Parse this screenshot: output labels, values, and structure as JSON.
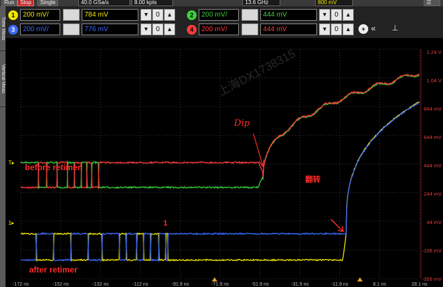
{
  "toolbar": {
    "run": "Run",
    "stop": "Stop",
    "single": "Single",
    "sample_rate": "40.0 GSa/s",
    "memory": "8.00 kpts",
    "bandwidth": "13.6 GHz",
    "trig_level": "800 mV"
  },
  "channels": [
    {
      "num": "1",
      "color": "#f2e600",
      "scale": "200 mV/",
      "offset": "784 mV"
    },
    {
      "num": "2",
      "color": "#3ad23a",
      "scale": "200 mV/",
      "offset": "444 mV"
    },
    {
      "num": "3",
      "color": "#3a6bff",
      "scale": "200 mV/",
      "offset": "776 mV"
    },
    {
      "num": "4",
      "color": "#ff3b3b",
      "scale": "200 mV/",
      "offset": "444 mV"
    }
  ],
  "side_tabs": {
    "tab1": "Time Meas",
    "tab2": "Vertical Meas"
  },
  "y_ticks": [
    "1.24 V",
    "1.04 V",
    "844 mV",
    "644 mV",
    "444 mV",
    "244 mV",
    "44 mV",
    "-156 mV",
    "-356 mV"
  ],
  "x_ticks": [
    "-172 ns",
    "-152 ns",
    "-132 ns",
    "-112 ns",
    "-91.9 ns",
    "-71.9 ns",
    "-51.9 ns",
    "-31.9 ns",
    "-11.9 ns",
    "8.1 ns",
    "28.1 ns"
  ],
  "annotations": {
    "before": "before retimer",
    "after": "after retimer",
    "dip": "Dip",
    "flip": "翻转",
    "one": "1"
  },
  "watermark": "上海DX1738315",
  "colors": {
    "annot_red": "#ff2a2a",
    "grid": "#3a3a3a"
  }
}
